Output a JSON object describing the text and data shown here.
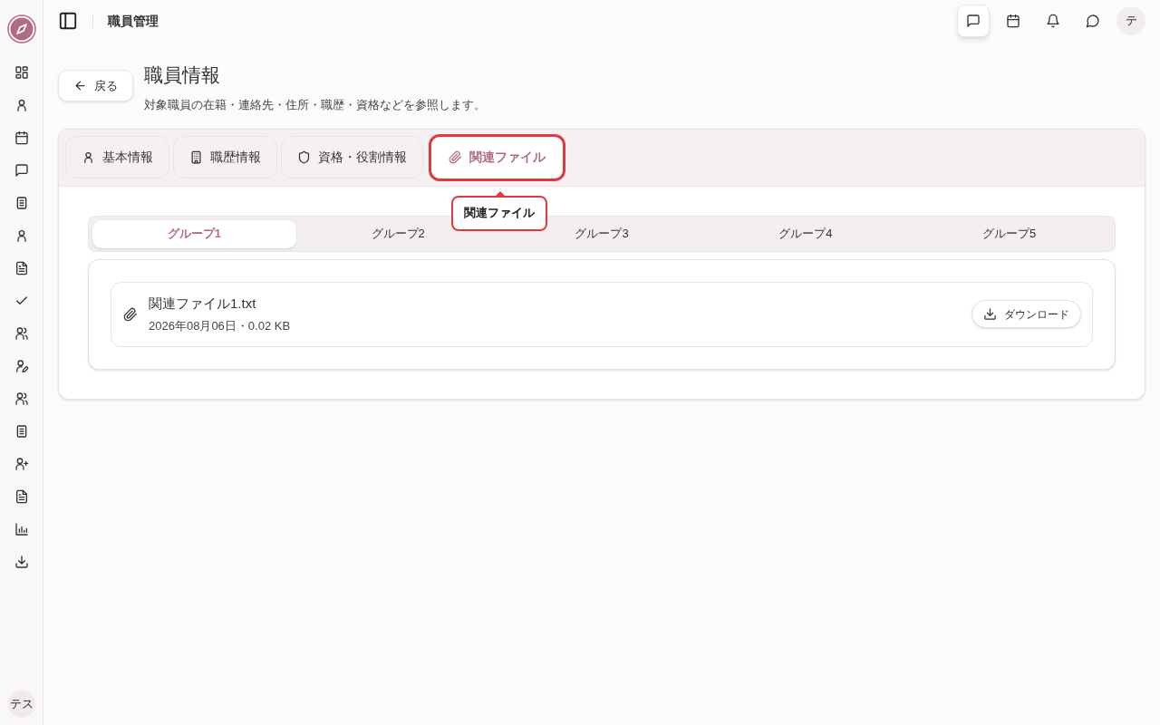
{
  "sidebar": {
    "items": [
      {
        "kind": "grid"
      },
      {
        "kind": "user"
      },
      {
        "kind": "calendar"
      },
      {
        "kind": "message"
      },
      {
        "kind": "document"
      },
      {
        "kind": "user"
      },
      {
        "kind": "file"
      },
      {
        "kind": "check"
      },
      {
        "kind": "users"
      },
      {
        "kind": "user-pen"
      },
      {
        "kind": "users"
      },
      {
        "kind": "document"
      },
      {
        "kind": "user-plus"
      },
      {
        "kind": "file"
      },
      {
        "kind": "chart"
      },
      {
        "kind": "download"
      }
    ],
    "avatar": "テス"
  },
  "header": {
    "title": "職員管理",
    "buttons": [
      {
        "kind": "message",
        "selected": true
      },
      {
        "kind": "calendar",
        "selected": false
      },
      {
        "kind": "bell",
        "selected": false
      },
      {
        "kind": "chat",
        "selected": false
      }
    ],
    "avatar": "テ"
  },
  "page": {
    "back": "戻る",
    "title": "職員情報",
    "subtitle": "対象職員の在籍・連絡先・住所・職歴・資格などを参照します。"
  },
  "tabs": [
    {
      "label": "基本情報",
      "kind": "user",
      "selected": false,
      "focused": false
    },
    {
      "label": "職歴情報",
      "kind": "building",
      "selected": false,
      "focused": false
    },
    {
      "label": "資格・役割情報",
      "kind": "shield",
      "selected": false,
      "focused": false
    },
    {
      "label": "関連ファイル",
      "kind": "paperclip",
      "selected": true,
      "focused": true
    }
  ],
  "tooltip": "関連ファイル",
  "groups": [
    {
      "label": "グループ1",
      "selected": true
    },
    {
      "label": "グループ2",
      "selected": false
    },
    {
      "label": "グループ3",
      "selected": false
    },
    {
      "label": "グループ4",
      "selected": false
    },
    {
      "label": "グループ5",
      "selected": false
    }
  ],
  "files": [
    {
      "name": "関連ファイル1.txt",
      "meta": "2026年08月06日・0.02 KB",
      "action": "ダウンロード"
    }
  ]
}
